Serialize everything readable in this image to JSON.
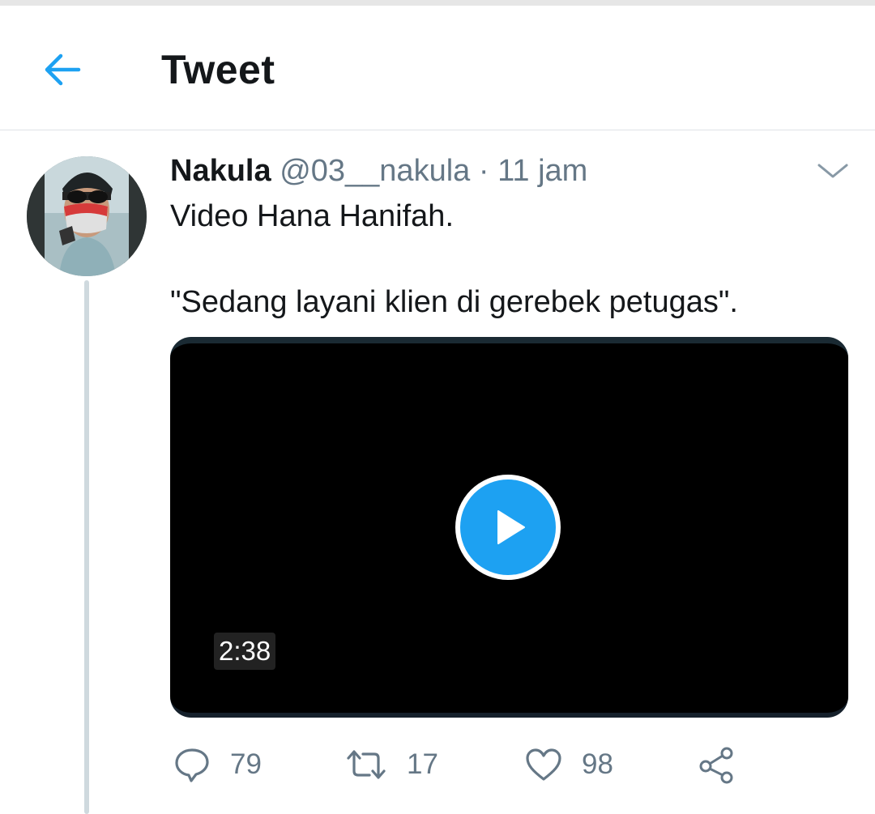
{
  "header": {
    "title": "Tweet",
    "back_icon": "arrow-left-icon",
    "accent_color": "#1da1f2"
  },
  "tweet": {
    "author_name": "Nakula",
    "handle": "@03__nakula",
    "separator": "·",
    "time": "11 jam",
    "text_line1": "Video Hana Hanifah.",
    "text_line2": "\"Sedang layani klien di gerebek petugas\".",
    "menu_icon": "chevron-down-icon",
    "avatar_icon": "avatar-photo"
  },
  "video": {
    "duration": "2:38",
    "play_icon": "play-icon"
  },
  "actions": {
    "reply_count": "79",
    "retweet_count": "17",
    "like_count": "98",
    "reply_icon": "reply-icon",
    "retweet_icon": "retweet-icon",
    "like_icon": "heart-icon",
    "share_icon": "share-icon"
  }
}
